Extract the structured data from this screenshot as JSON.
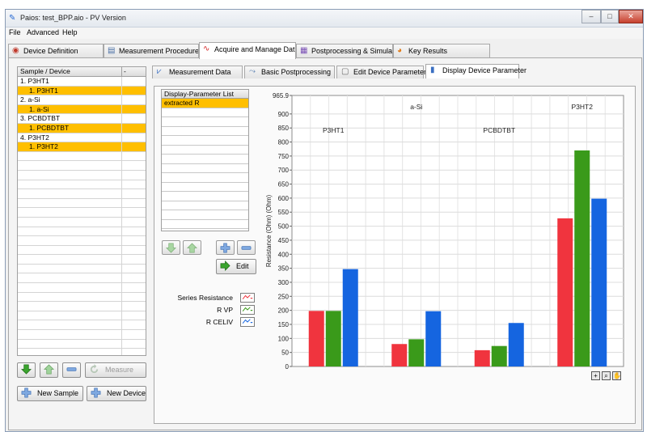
{
  "window": {
    "title": "Paios: test_BPP.aio  -  PV Version",
    "controls": {
      "minimize": "–",
      "maximize": "□",
      "close": "✕"
    }
  },
  "menu": [
    "File",
    "Advanced",
    "Help"
  ],
  "main_tabs": [
    {
      "label": "Device Definition",
      "icon": "device-icon"
    },
    {
      "label": "Measurement Procedure",
      "icon": "document-icon"
    },
    {
      "label": "Acquire and Manage Data",
      "icon": "waveform-icon"
    },
    {
      "label": "Postprocessing & Simulation",
      "icon": "chart-icon"
    },
    {
      "label": "Key Results",
      "icon": "pie-icon"
    }
  ],
  "device_table": {
    "header": "Sample / Device",
    "header2": "-",
    "rows": [
      {
        "label": "1. P3HT1",
        "child": false
      },
      {
        "label": "1. P3HT1",
        "child": true
      },
      {
        "label": "2. a-Si",
        "child": false
      },
      {
        "label": "1. a-Si",
        "child": true
      },
      {
        "label": "3. PCBDTBT",
        "child": false
      },
      {
        "label": "1. PCBDTBT",
        "child": true
      },
      {
        "label": "4. P3HT2",
        "child": false
      },
      {
        "label": "1. P3HT2",
        "child": true
      }
    ]
  },
  "buttons": {
    "measure": "Measure",
    "new_sample": "New Sample",
    "new_device": "New Device",
    "edit": "Edit"
  },
  "sub_tabs": [
    {
      "label": "Measurement Data",
      "icon": "plot-icon"
    },
    {
      "label": "Basic Postprocessing",
      "icon": "graph-icon"
    },
    {
      "label": "Edit Device Parameter",
      "icon": "doc-icon"
    },
    {
      "label": "Display Device Parameter",
      "icon": "bars-icon"
    }
  ],
  "display_list": {
    "header": "Display-Parameter List",
    "items": [
      "extracted R"
    ]
  },
  "legend": [
    {
      "name": "Series Resistance",
      "color": "#f0343e"
    },
    {
      "name": "R VP",
      "color": "#3a9a1a"
    },
    {
      "name": "R CELIV",
      "color": "#1565e0"
    }
  ],
  "chart_data": {
    "type": "bar",
    "categories": [
      "P3HT1",
      "a-Si",
      "PCBDTBT",
      "P3HT2"
    ],
    "series": [
      {
        "name": "Series Resistance",
        "values": [
          198,
          80,
          58,
          528
        ]
      },
      {
        "name": "R VP",
        "values": [
          198,
          97,
          73,
          770
        ]
      },
      {
        "name": "R CELIV",
        "values": [
          347,
          197,
          155,
          598
        ]
      }
    ],
    "ylabel": "Resistance (Ohm) (Ohm)",
    "ylim": [
      0,
      965.9
    ],
    "yticks": [
      "0",
      "50",
      "100",
      "150",
      "200",
      "250",
      "300",
      "350",
      "400",
      "450",
      "500",
      "550",
      "600",
      "650",
      "700",
      "750",
      "800",
      "850",
      "900",
      "965.9"
    ],
    "grid": true,
    "colors": [
      "#f0343e",
      "#3a9a1a",
      "#1565e0"
    ]
  }
}
